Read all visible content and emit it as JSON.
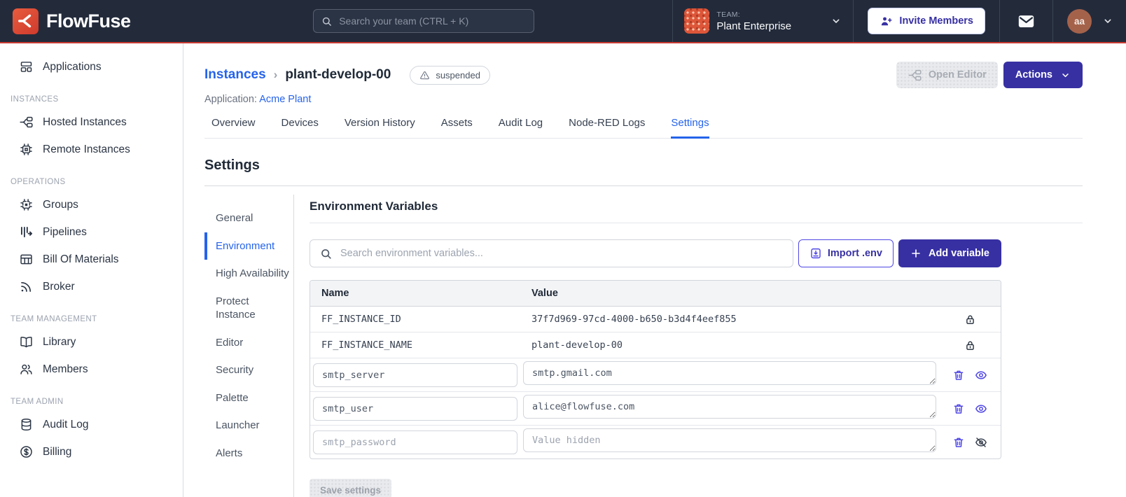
{
  "colors": {
    "navbar_bg": "#232b3b",
    "navbar_accent_red": "#ca3a33",
    "brand_red": "#d9452f",
    "indigo_button": "#3730a3",
    "indigo_icon": "#4f46e5",
    "active_blue": "#2563eb",
    "table_header_bg": "#f3f4f6",
    "user_avatar_bg": "#a5624b",
    "team_avatar_bg": "#dd5639"
  },
  "icons": {
    "flowfuse-logo-icon": "red square with white flow chevron",
    "search-icon": "magnifier",
    "chevron-down-icon": "v chevron",
    "invite-members-icon": "person with plus",
    "mail-icon": "envelope",
    "applications-icon": "stacked app tiles",
    "hosted-instances-icon": "node-red flow nodes",
    "remote-instances-icon": "cpu chip",
    "groups-icon": "dashed chip",
    "pipelines-icon": "bars with arrow",
    "bom-icon": "spreadsheet table",
    "broker-icon": "broadcast rss waves",
    "library-icon": "open book",
    "members-icon": "two people",
    "audit-log-icon": "database cylinder",
    "billing-icon": "dollar in circle",
    "warning-icon": "warning triangle",
    "import-env-icon": "document with down arrow",
    "plus-icon": "plus",
    "lock-icon": "padlock",
    "trash-icon": "trash can",
    "eye-icon": "open eye",
    "eye-off-icon": "eye with slash"
  },
  "navbar": {
    "brand": "FlowFuse",
    "search_placeholder": "Search your team (CTRL + K)",
    "team_label": "TEAM:",
    "team_name": "Plant Enterprise",
    "invite_label": "Invite Members",
    "avatar_initials": "aa"
  },
  "sidebar": {
    "sections": [
      {
        "label": "",
        "items": [
          {
            "label": "Applications"
          }
        ]
      },
      {
        "label": "INSTANCES",
        "items": [
          {
            "label": "Hosted Instances"
          },
          {
            "label": "Remote Instances"
          }
        ]
      },
      {
        "label": "OPERATIONS",
        "items": [
          {
            "label": "Groups"
          },
          {
            "label": "Pipelines"
          },
          {
            "label": "Bill Of Materials"
          },
          {
            "label": "Broker"
          }
        ]
      },
      {
        "label": "TEAM MANAGEMENT",
        "items": [
          {
            "label": "Library"
          },
          {
            "label": "Members"
          }
        ]
      },
      {
        "label": "TEAM ADMIN",
        "items": [
          {
            "label": "Audit Log"
          },
          {
            "label": "Billing"
          }
        ]
      }
    ]
  },
  "page": {
    "breadcrumb": {
      "root": "Instances",
      "separator": "›",
      "current": "plant-develop-00"
    },
    "status_badge": "suspended",
    "application_label": "Application:",
    "application_name": "Acme Plant",
    "open_editor_label": "Open Editor",
    "actions_label": "Actions",
    "tabs": [
      {
        "label": "Overview"
      },
      {
        "label": "Devices"
      },
      {
        "label": "Version History"
      },
      {
        "label": "Assets"
      },
      {
        "label": "Audit Log"
      },
      {
        "label": "Node-RED Logs"
      },
      {
        "label": "Settings",
        "active": true
      }
    ]
  },
  "settings": {
    "title": "Settings",
    "nav": [
      {
        "label": "General"
      },
      {
        "label": "Environment",
        "active": true
      },
      {
        "label": "High Availability"
      },
      {
        "label": "Protect Instance"
      },
      {
        "label": "Editor"
      },
      {
        "label": "Security"
      },
      {
        "label": "Palette"
      },
      {
        "label": "Launcher"
      },
      {
        "label": "Alerts"
      }
    ],
    "environment": {
      "title": "Environment Variables",
      "search_placeholder": "Search environment variables...",
      "import_button": "Import .env",
      "add_button": "Add variable",
      "columns": {
        "name": "Name",
        "value": "Value"
      },
      "locked_rows": [
        {
          "name": "FF_INSTANCE_ID",
          "value": "37f7d969-97cd-4000-b650-b3d4f4eef855"
        },
        {
          "name": "FF_INSTANCE_NAME",
          "value": "plant-develop-00"
        }
      ],
      "editable_rows": [
        {
          "name": "smtp_server",
          "value": "smtp.gmail.com"
        },
        {
          "name": "smtp_user",
          "value": "alice@flowfuse.com"
        },
        {
          "name": "smtp_password",
          "value": "",
          "value_placeholder": "Value hidden"
        }
      ],
      "save_button": "Save settings"
    }
  }
}
